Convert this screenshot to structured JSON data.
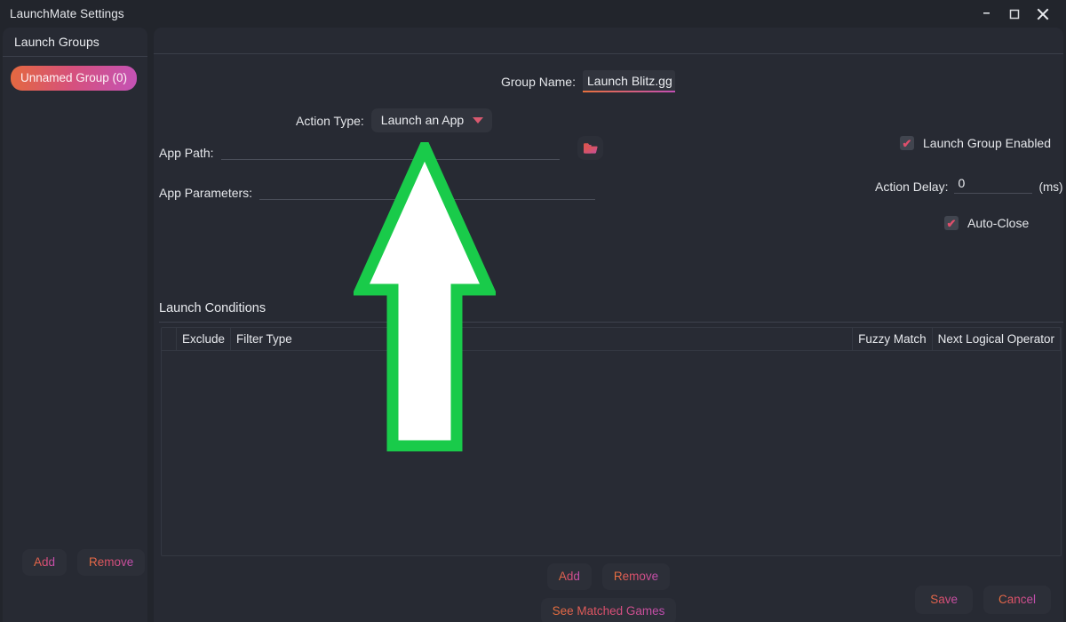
{
  "window": {
    "title": "LaunchMate Settings",
    "controls": {
      "minimize": "–",
      "maximize": "☐",
      "close": "✕"
    }
  },
  "sidebar": {
    "header": "Launch Groups",
    "groups": [
      {
        "label": "Unnamed Group (0)"
      }
    ],
    "add_label": "Add",
    "remove_label": "Remove"
  },
  "form": {
    "group_name_label": "Group Name:",
    "group_name_value": "Launch Blitz.gg",
    "action_type_label": "Action Type:",
    "action_type_value": "Launch an App",
    "app_path_label": "App Path:",
    "app_path_value": "",
    "app_params_label": "App Parameters:",
    "app_params_value": "",
    "browse_icon": "folder-open-icon",
    "launch_group_enabled_label": "Launch Group Enabled",
    "launch_group_enabled_checked": "✔",
    "action_delay_label": "Action Delay:",
    "action_delay_value": "0",
    "action_delay_unit": "(ms)",
    "auto_close_label": "Auto-Close",
    "auto_close_checked": "✔"
  },
  "launch_conditions": {
    "title": "Launch Conditions",
    "columns": [
      "Exclude",
      "Filter Type",
      "Fuzzy Match",
      "Next Logical Operator"
    ],
    "rows": [],
    "add_label": "Add",
    "remove_label": "Remove",
    "see_matched_label": "See Matched Games"
  },
  "footer": {
    "save_label": "Save",
    "cancel_label": "Cancel"
  },
  "overlay": {
    "annotation": "up-arrow",
    "fill": "#ffffff",
    "stroke": "#19cb4a"
  },
  "colors": {
    "window_bg": "#22252c",
    "panel_bg": "#272a33",
    "accent_start": "#e8713c",
    "accent_end": "#c24fb5",
    "checkmark": "#dd4f6b"
  }
}
